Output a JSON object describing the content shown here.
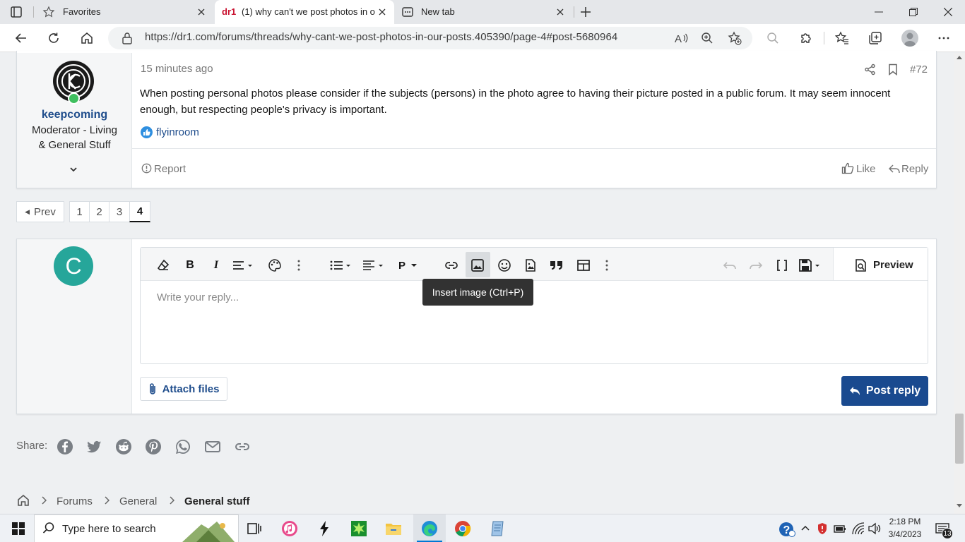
{
  "browser": {
    "tabs": [
      {
        "label": "Favorites"
      },
      {
        "label": "(1) why can't we post photos in o",
        "favicon": "dr1"
      },
      {
        "label": "New tab"
      }
    ],
    "url": "https://dr1.com/forums/threads/why-cant-we-post-photos-in-our-posts.405390/page-4#post-5680964"
  },
  "post": {
    "time": "15 minutes ago",
    "number": "#72",
    "body": "When posting personal photos please consider if the subjects (persons) in the photo agree to having their picture posted in a public forum. It may seem innocent enough, but respecting people's privacy is important.",
    "reaction_user": "flyinroom",
    "author": {
      "name": "keepcoming",
      "role_line1": "Moderator - Living",
      "role_line2": "& General Stuff"
    },
    "report_label": "Report",
    "like_label": "Like",
    "reply_label": "Reply"
  },
  "pagination": {
    "prev_label": "Prev",
    "pages": [
      "1",
      "2",
      "3",
      "4"
    ],
    "current": "4"
  },
  "editor": {
    "avatar_letter": "C",
    "avatar_color": "#26a69a",
    "placeholder": "Write your reply...",
    "tooltip": "Insert image (Ctrl+P)",
    "preview_label": "Preview",
    "attach_label": "Attach files",
    "post_reply_label": "Post reply",
    "paragraph_label": "P"
  },
  "share": {
    "label": "Share:"
  },
  "breadcrumb": {
    "items": [
      "Forums",
      "General"
    ],
    "current": "General stuff"
  },
  "taskbar": {
    "search_placeholder": "Type here to search",
    "time": "2:18 PM",
    "date": "3/4/2023",
    "notification_count": "13"
  },
  "colors": {
    "accent": "#1f4d8c",
    "button": "#1a4a8f"
  }
}
